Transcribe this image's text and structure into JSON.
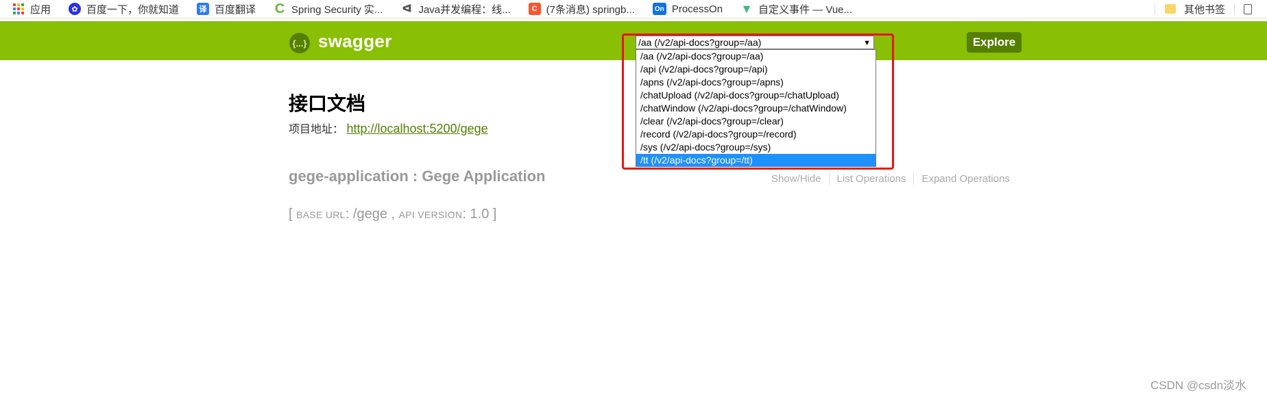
{
  "bookmarks": {
    "items": [
      {
        "label": "应用",
        "icon": "apps-grid-icon"
      },
      {
        "label": "百度一下，你就知道",
        "icon": "baidu-paw-icon"
      },
      {
        "label": "百度翻译",
        "icon": "translate-icon"
      },
      {
        "label": "Spring Security 实...",
        "icon": "spring-icon"
      },
      {
        "label": "Java并发编程：线...",
        "icon": "yuque-icon"
      },
      {
        "label": "(7条消息) springb...",
        "icon": "csdn-icon"
      },
      {
        "label": "ProcessOn",
        "icon": "processon-icon"
      },
      {
        "label": "自定义事件 — Vue...",
        "icon": "vue-icon"
      }
    ],
    "other": "其他书签"
  },
  "header": {
    "logo_glyph": "{...}",
    "logo_text": "swagger",
    "explore_label": "Explore",
    "background": "#89bf04",
    "accent": "#547f00"
  },
  "api_select": {
    "current": "/aa (/v2/api-docs?group=/aa)",
    "options": [
      "/aa (/v2/api-docs?group=/aa)",
      "/api (/v2/api-docs?group=/api)",
      "/apns (/v2/api-docs?group=/apns)",
      "/chatUpload (/v2/api-docs?group=/chatUpload)",
      "/chatWindow (/v2/api-docs?group=/chatWindow)",
      "/clear (/v2/api-docs?group=/clear)",
      "/record (/v2/api-docs?group=/record)",
      "/sys (/v2/api-docs?group=/sys)",
      "/tt (/v2/api-docs?group=/tt)"
    ],
    "highlighted_index": 8
  },
  "main": {
    "title": "接口文档",
    "project_label": "项目地址：",
    "project_url": "http://localhost:5200/gege",
    "app_title": "gege-application : Gege Application",
    "ops": [
      "Show/Hide",
      "List Operations",
      "Expand Operations"
    ],
    "base_url_label": "BASE URL",
    "base_url_value": "/gege",
    "api_version_label": "API VERSION",
    "api_version_value": "1.0"
  },
  "watermark": "CSDN @csdn淡水"
}
